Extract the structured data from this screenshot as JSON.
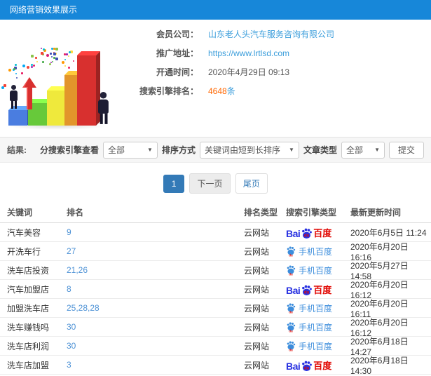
{
  "header": {
    "title": "网络营销效果展示"
  },
  "info": {
    "member_label": "会员公司：",
    "member_value": "山东老人头汽车服务咨询有限公司",
    "url_label": "推广地址：",
    "url_value": "https://www.lrtlsd.com",
    "open_time_label": "开通时间：",
    "open_time_value": "2020年4月29日 09:13",
    "rank_count_label": "搜索引擎排名：",
    "rank_count_value": "4648",
    "rank_count_suffix": "条"
  },
  "filters": {
    "section_label": "结果:",
    "engine_label": "分搜索引擎查看",
    "engine_value": "全部",
    "sort_label": "排序方式",
    "sort_value": "关键词由短到长排序",
    "article_label": "文章类型",
    "article_value": "全部",
    "submit_label": "提交",
    "caret": "▼"
  },
  "pagination": {
    "current": "1",
    "next_label": "下一页",
    "last_label": "尾页"
  },
  "table": {
    "headers": [
      "关键词",
      "排名",
      "排名类型",
      "搜索引擎类型",
      "最新更新时间"
    ],
    "rows": [
      {
        "keyword": "汽车美容",
        "rank": "9",
        "rank_type": "云网站",
        "engine": "baidu_pc",
        "time": "2020年6月5日 11:24"
      },
      {
        "keyword": "开洗车行",
        "rank": "27",
        "rank_type": "云网站",
        "engine": "baidu_mobile",
        "time": "2020年6月20日 16:16"
      },
      {
        "keyword": "洗车店投资",
        "rank": "21,26",
        "rank_type": "云网站",
        "engine": "baidu_mobile",
        "time": "2020年5月27日 14:58"
      },
      {
        "keyword": "汽车加盟店",
        "rank": "8",
        "rank_type": "云网站",
        "engine": "baidu_pc",
        "time": "2020年6月20日 16:12"
      },
      {
        "keyword": "加盟洗车店",
        "rank": "25,28,28",
        "rank_type": "云网站",
        "engine": "baidu_mobile",
        "time": "2020年6月20日 16:11"
      },
      {
        "keyword": "洗车赚钱吗",
        "rank": "30",
        "rank_type": "云网站",
        "engine": "baidu_mobile",
        "time": "2020年6月20日 16:12"
      },
      {
        "keyword": "洗车店利润",
        "rank": "30",
        "rank_type": "云网站",
        "engine": "baidu_mobile",
        "time": "2020年6月18日 14:27"
      },
      {
        "keyword": "洗车店加盟",
        "rank": "3",
        "rank_type": "云网站",
        "engine": "baidu_pc",
        "time": "2020年6月18日 14:30"
      }
    ]
  },
  "engine_labels": {
    "baidu_pc": {
      "bai": "Bai",
      "du": "du",
      "cn": "百度"
    },
    "baidu_mobile": {
      "label": "手机百度",
      "du": "du"
    }
  },
  "colors": {
    "topbar_bg": "#1787d9",
    "link_blue": "#3a9ddb",
    "rank_blue": "#4f93d6",
    "count_orange": "#ff6600",
    "pagination_active": "#337ab7",
    "baidu_blue": "#2932e1",
    "baidu_red": "#e10601"
  },
  "illustration": {
    "bar_colors": [
      "#4a7de0",
      "#67c93a",
      "#efe93c",
      "#e2952b",
      "#d8302f"
    ],
    "confetti_colors": [
      "#e91e63",
      "#9c27b0",
      "#3f51b5",
      "#03a9f4",
      "#4caf50",
      "#ffd93b",
      "#ff9800",
      "#f44336",
      "#00bcd4",
      "#8bc34a"
    ]
  }
}
